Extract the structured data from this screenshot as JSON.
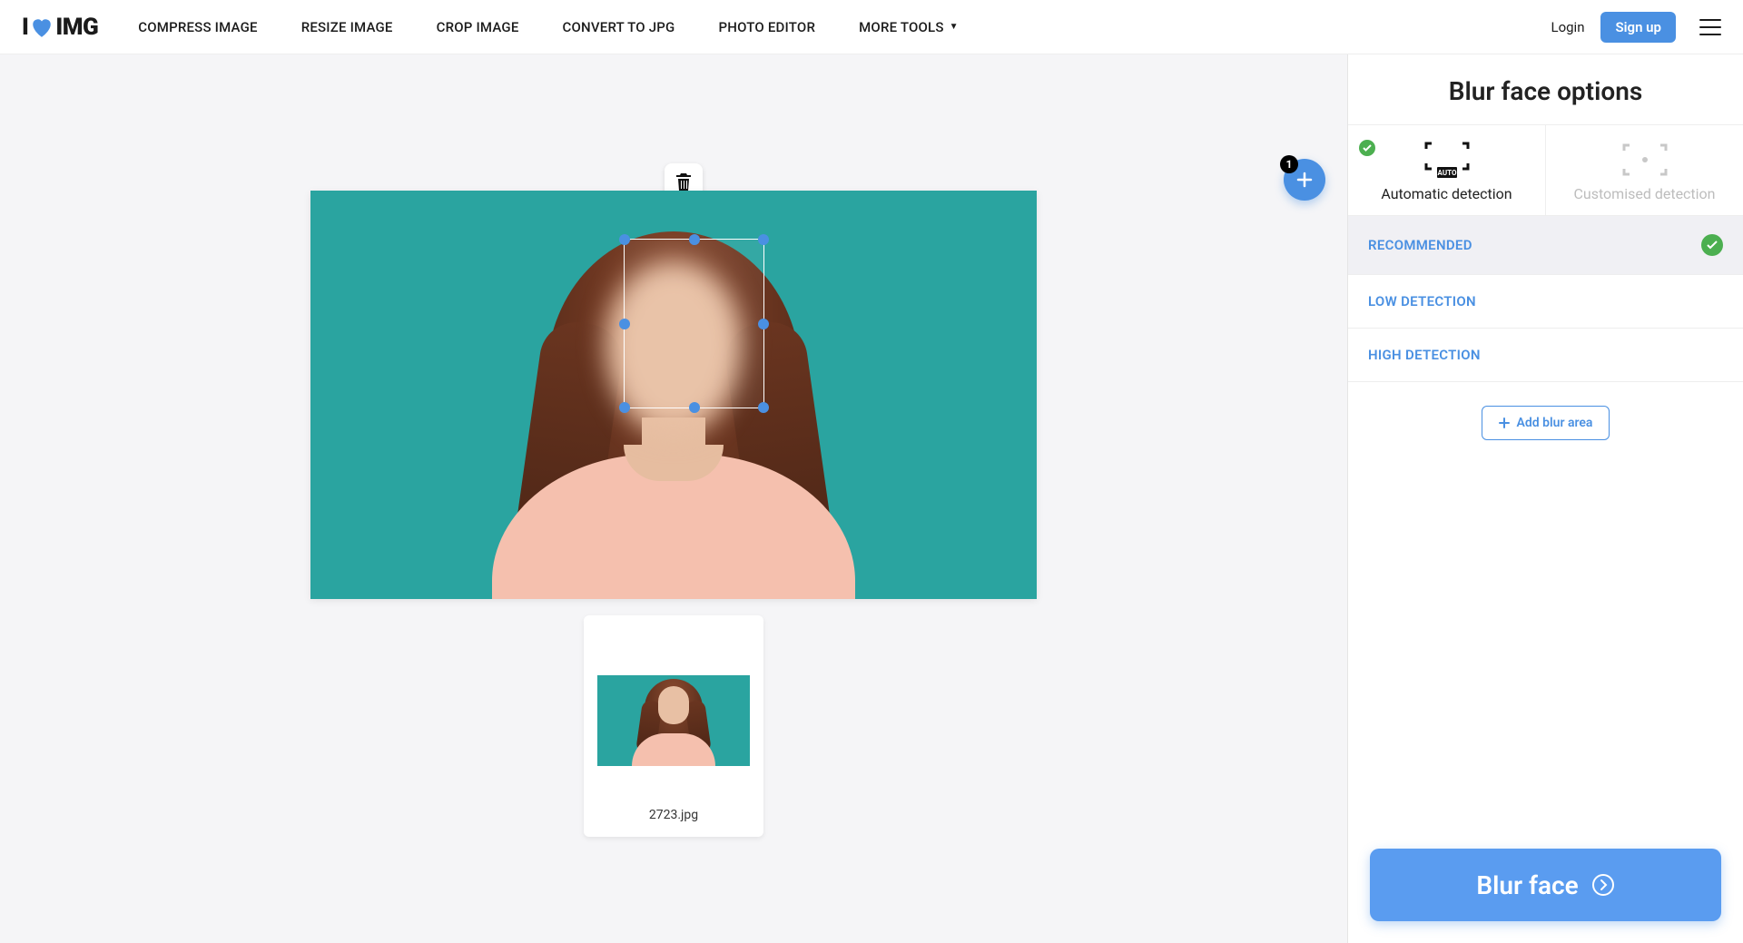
{
  "header": {
    "logo_prefix": "I",
    "logo_suffix": "IMG",
    "nav": {
      "compress": "COMPRESS IMAGE",
      "resize": "RESIZE IMAGE",
      "crop": "CROP IMAGE",
      "convert": "CONVERT TO JPG",
      "editor": "PHOTO EDITOR",
      "more": "MORE TOOLS"
    },
    "login": "Login",
    "signup": "Sign up"
  },
  "canvas": {
    "add_badge": "1",
    "thumb_filename": "2723.jpg"
  },
  "sidebar": {
    "title": "Blur face options",
    "tab_auto": "Automatic detection",
    "tab_custom": "Customised detection",
    "levels": {
      "recommended": "RECOMMENDED",
      "low": "LOW DETECTION",
      "high": "HIGH DETECTION"
    },
    "add_blur": "Add blur area",
    "process": "Blur face"
  }
}
